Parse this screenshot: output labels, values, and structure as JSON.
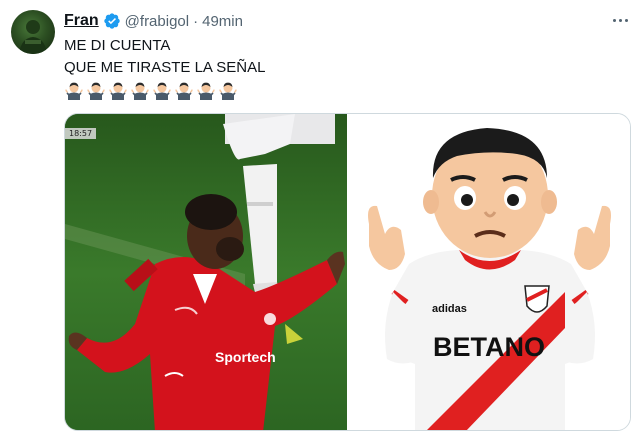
{
  "author": {
    "display_name": "Fran",
    "handle": "@frabigol",
    "separator": "·",
    "time": "49min",
    "verified": true,
    "verified_color": "#1d9bf0",
    "avatar_icon": "avatar"
  },
  "tweet": {
    "lines": [
      "ME DI CUENTA",
      "QUE ME TIRASTE LA SEÑAL"
    ],
    "emoji_name": "man-shrugging-emoji",
    "emoji_count": 8
  },
  "media": {
    "left_image": {
      "description_icon": "football-player-celebrating-image",
      "timer": "18:57",
      "jersey_text": "Sportech",
      "jersey_color": "#d3121c"
    },
    "right_image": {
      "description_icon": "shrugging-emoji-river-plate-jersey-image",
      "jersey_sponsor": "BETANO",
      "brand_text": "adidas",
      "stripe_color": "#e02020"
    }
  },
  "more_icon": "more-options-icon"
}
